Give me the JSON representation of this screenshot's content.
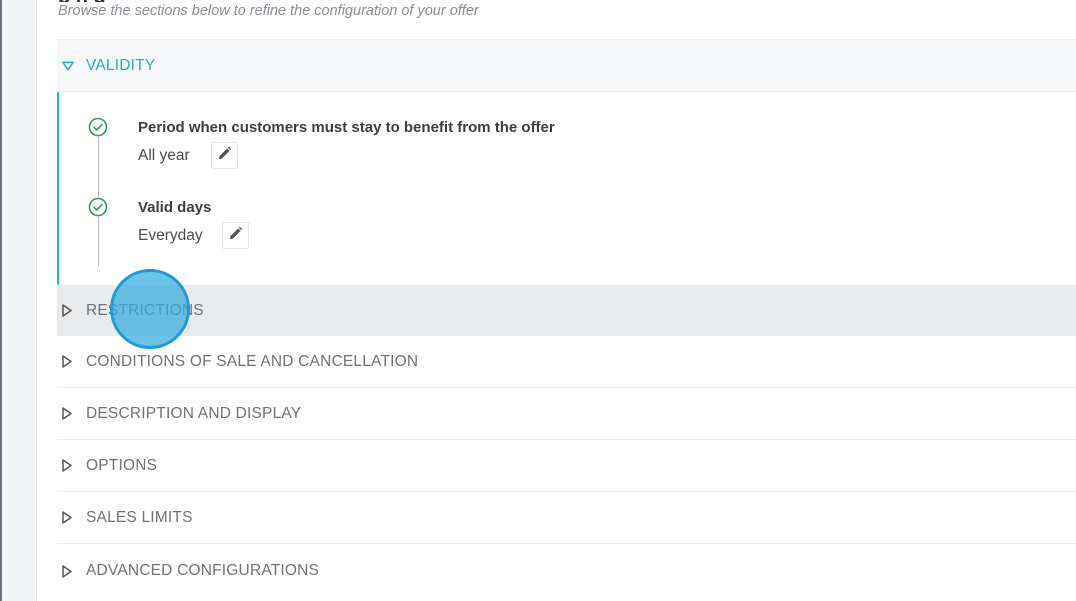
{
  "page": {
    "subtitle": "Browse the sections below to refine the configuration of your offer"
  },
  "sections": {
    "validity": {
      "label": "VALIDITY",
      "steps": [
        {
          "title": "Period when customers must stay to benefit from the offer",
          "value": "All year"
        },
        {
          "title": "Valid days",
          "value": "Everyday"
        }
      ]
    },
    "collapsed": [
      {
        "label": "RESTRICTIONS"
      },
      {
        "label": "CONDITIONS OF SALE AND CANCELLATION"
      },
      {
        "label": "DESCRIPTION AND DISPLAY"
      },
      {
        "label": "OPTIONS"
      },
      {
        "label": "SALES LIMITS"
      },
      {
        "label": "ADVANCED CONFIGURATIONS"
      }
    ]
  },
  "icons": {
    "expanded": "triangle-down-icon",
    "collapsed": "triangle-right-icon",
    "step_done": "check-circle-icon",
    "edit": "pencil-icon"
  },
  "colors": {
    "accent": "#26b0bd",
    "success": "#2e9e5b",
    "hover_row": "#e8eaec",
    "click_indicator": "#34aae1"
  }
}
